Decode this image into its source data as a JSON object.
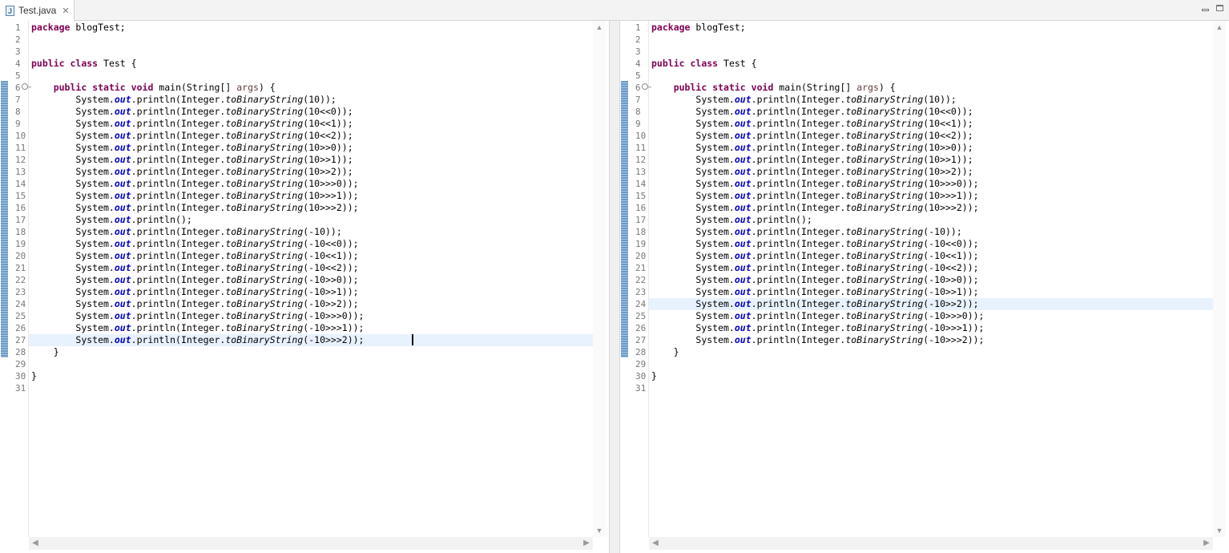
{
  "tab": {
    "label": "Test.java",
    "icon": "J"
  },
  "editor": {
    "accent_change_color": "#6b9ac9",
    "highlight_color": "#e8f2fe",
    "left": {
      "highlight_line": 27,
      "caret_line": 27
    },
    "right": {
      "highlight_line": 24
    },
    "lines": [
      {
        "n": "1",
        "code": [
          {
            "t": "package",
            "c": "kw"
          },
          {
            "t": " blogTest;",
            "c": ""
          }
        ]
      },
      {
        "n": "2",
        "code": []
      },
      {
        "n": "3",
        "code": []
      },
      {
        "n": "4",
        "code": [
          {
            "t": "public",
            "c": "kw"
          },
          {
            "t": " ",
            "c": ""
          },
          {
            "t": "class",
            "c": "kw"
          },
          {
            "t": " Test {",
            "c": ""
          }
        ]
      },
      {
        "n": "5",
        "code": []
      },
      {
        "n": "6",
        "fold": true,
        "code": [
          {
            "t": "    ",
            "c": ""
          },
          {
            "t": "public",
            "c": "kw"
          },
          {
            "t": " ",
            "c": ""
          },
          {
            "t": "static",
            "c": "kw"
          },
          {
            "t": " ",
            "c": ""
          },
          {
            "t": "void",
            "c": "kw"
          },
          {
            "t": " main(String[] ",
            "c": ""
          },
          {
            "t": "args",
            "c": "param"
          },
          {
            "t": ") {",
            "c": ""
          }
        ]
      },
      {
        "n": "7",
        "arg": "10"
      },
      {
        "n": "8",
        "arg": "10<<0"
      },
      {
        "n": "9",
        "arg": "10<<1"
      },
      {
        "n": "10",
        "arg": "10<<2"
      },
      {
        "n": "11",
        "arg": "10>>0"
      },
      {
        "n": "12",
        "arg": "10>>1"
      },
      {
        "n": "13",
        "arg": "10>>2"
      },
      {
        "n": "14",
        "arg": "10>>>0"
      },
      {
        "n": "15",
        "arg": "10>>>1"
      },
      {
        "n": "16",
        "arg": "10>>>2"
      },
      {
        "n": "17",
        "empty_println": true
      },
      {
        "n": "18",
        "arg": "-10"
      },
      {
        "n": "19",
        "arg": "-10<<0"
      },
      {
        "n": "20",
        "arg": "-10<<1"
      },
      {
        "n": "21",
        "arg": "-10<<2"
      },
      {
        "n": "22",
        "arg": "-10>>0"
      },
      {
        "n": "23",
        "arg": "-10>>1"
      },
      {
        "n": "24",
        "arg": "-10>>2"
      },
      {
        "n": "25",
        "arg": "-10>>>0"
      },
      {
        "n": "26",
        "arg": "-10>>>1"
      },
      {
        "n": "27",
        "arg": "-10>>>2"
      },
      {
        "n": "28",
        "code": [
          {
            "t": "    }",
            "c": ""
          }
        ]
      },
      {
        "n": "29",
        "code": []
      },
      {
        "n": "30",
        "code": [
          {
            "t": "}",
            "c": ""
          }
        ]
      },
      {
        "n": "31",
        "code": []
      }
    ],
    "tokens": {
      "indent": "        ",
      "system": "System.",
      "out": "out",
      "println_open": ".println(",
      "integer": "Integer.",
      "method": "toBinaryString",
      "paren": "(",
      "close": "));",
      "println_empty": ".println();"
    }
  }
}
